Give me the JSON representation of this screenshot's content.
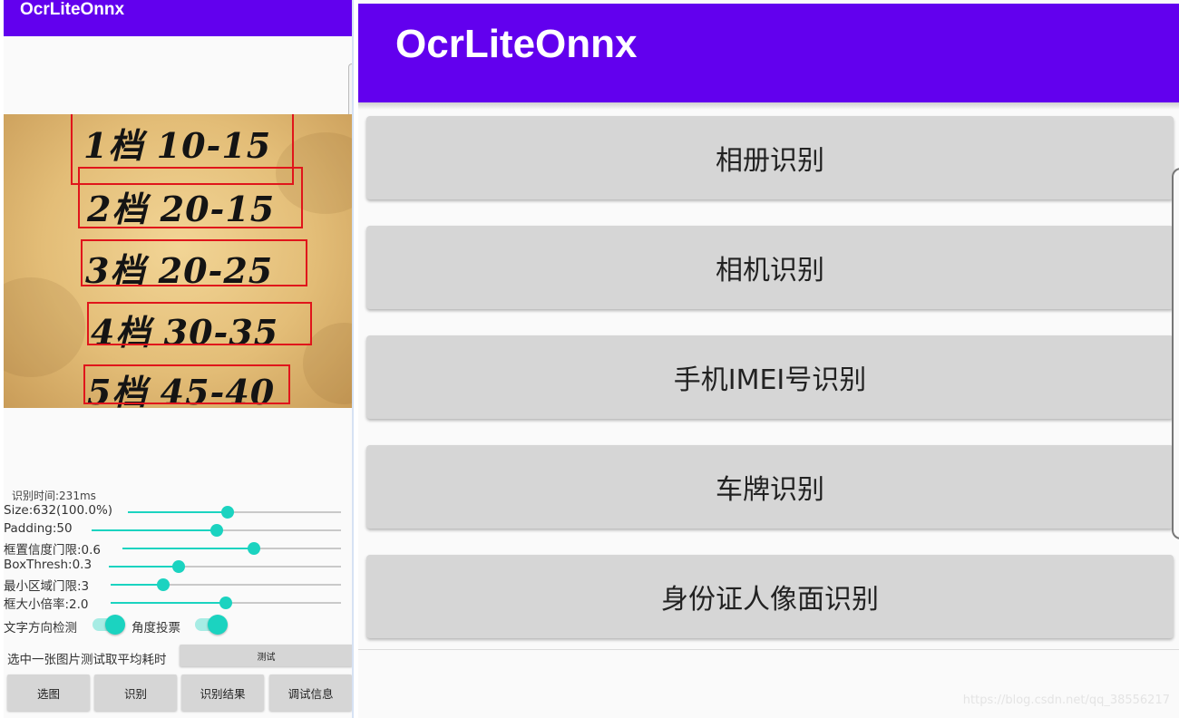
{
  "left_panel": {
    "title": "OcrLiteOnnx",
    "image": {
      "lines": [
        "1档 10-15",
        "2档 20-15",
        "3档 20-25",
        "4档 30-35",
        "5档 45-40"
      ]
    },
    "recognition_time": "识别时间:231ms",
    "sliders": [
      {
        "label": "Size:632(100.0%)",
        "value_fraction": 0.47
      },
      {
        "label": "Padding:50",
        "value_fraction": 0.5
      },
      {
        "label": "框置信度门限:0.6",
        "value_fraction": 0.6
      },
      {
        "label": "BoxThresh:0.3",
        "value_fraction": 0.3
      },
      {
        "label": "最小区域门限:3",
        "value_fraction": 0.23
      },
      {
        "label": "框大小倍率:2.0",
        "value_fraction": 0.5
      }
    ],
    "toggles": [
      {
        "label": "文字方向检测",
        "on": true
      },
      {
        "label": "角度投票",
        "on": true
      }
    ],
    "benchmark_label": "选中一张图片测试取平均耗时",
    "benchmark_button": "测试",
    "bottom_buttons": [
      "选图",
      "识别",
      "识别结果",
      "调试信息"
    ]
  },
  "right_panel": {
    "title": "OcrLiteOnnx",
    "menu_buttons": [
      "相册识别",
      "相机识别",
      "手机IMEI号识别",
      "车牌识别",
      "身份证人像面识别"
    ],
    "watermark": "https://blog.csdn.net/qq_38556217"
  },
  "colors": {
    "app_bar": "#6200ee",
    "accent": "#1bd3c0",
    "button_bg": "#d6d6d6",
    "detection_box": "#e0151b"
  }
}
